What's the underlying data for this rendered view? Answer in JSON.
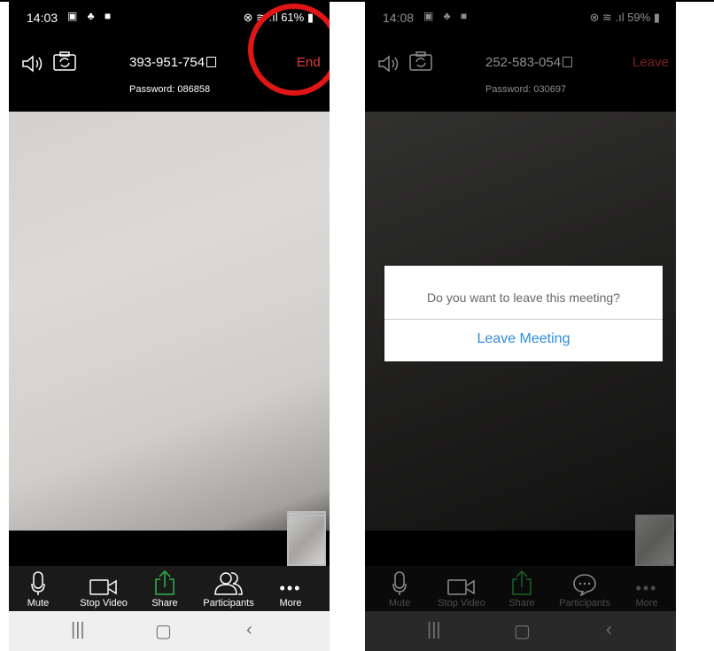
{
  "phone_left": {
    "status": {
      "time": "14:03",
      "battery": "61%"
    },
    "meeting_id": "393-951-754",
    "password_label": "Password: 086858",
    "end_label": "End",
    "toolbar": [
      "Mute",
      "Stop Video",
      "Share",
      "Participants",
      "More"
    ],
    "highlight_color": "#e01515"
  },
  "phone_right": {
    "status": {
      "time": "14:08",
      "battery": "59%"
    },
    "meeting_id": "252-583-054",
    "password_label": "Password: 030697",
    "leave_label": "Leave",
    "toolbar": [
      "Mute",
      "Stop Video",
      "Share",
      "Participants",
      "More"
    ],
    "dialog": {
      "question": "Do you want to leave this meeting?",
      "button": "Leave Meeting"
    }
  },
  "colors": {
    "end_red": "#e3393a",
    "link_blue": "#2d8cde",
    "share_green": "#2fb34a"
  }
}
